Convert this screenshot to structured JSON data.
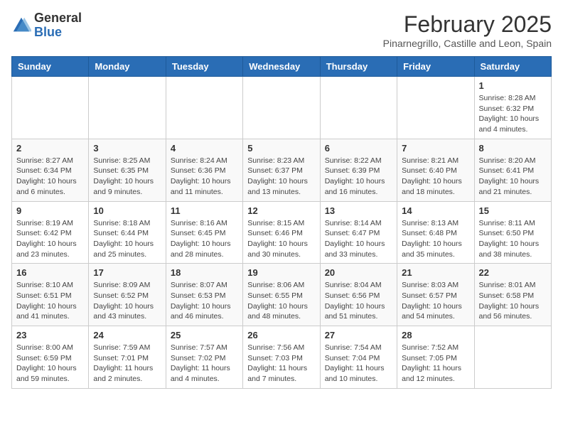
{
  "header": {
    "logo_general": "General",
    "logo_blue": "Blue",
    "month_year": "February 2025",
    "location": "Pinarnegrillo, Castille and Leon, Spain"
  },
  "weekdays": [
    "Sunday",
    "Monday",
    "Tuesday",
    "Wednesday",
    "Thursday",
    "Friday",
    "Saturday"
  ],
  "weeks": [
    [
      {
        "day": "",
        "info": ""
      },
      {
        "day": "",
        "info": ""
      },
      {
        "day": "",
        "info": ""
      },
      {
        "day": "",
        "info": ""
      },
      {
        "day": "",
        "info": ""
      },
      {
        "day": "",
        "info": ""
      },
      {
        "day": "1",
        "info": "Sunrise: 8:28 AM\nSunset: 6:32 PM\nDaylight: 10 hours and 4 minutes."
      }
    ],
    [
      {
        "day": "2",
        "info": "Sunrise: 8:27 AM\nSunset: 6:34 PM\nDaylight: 10 hours and 6 minutes."
      },
      {
        "day": "3",
        "info": "Sunrise: 8:25 AM\nSunset: 6:35 PM\nDaylight: 10 hours and 9 minutes."
      },
      {
        "day": "4",
        "info": "Sunrise: 8:24 AM\nSunset: 6:36 PM\nDaylight: 10 hours and 11 minutes."
      },
      {
        "day": "5",
        "info": "Sunrise: 8:23 AM\nSunset: 6:37 PM\nDaylight: 10 hours and 13 minutes."
      },
      {
        "day": "6",
        "info": "Sunrise: 8:22 AM\nSunset: 6:39 PM\nDaylight: 10 hours and 16 minutes."
      },
      {
        "day": "7",
        "info": "Sunrise: 8:21 AM\nSunset: 6:40 PM\nDaylight: 10 hours and 18 minutes."
      },
      {
        "day": "8",
        "info": "Sunrise: 8:20 AM\nSunset: 6:41 PM\nDaylight: 10 hours and 21 minutes."
      }
    ],
    [
      {
        "day": "9",
        "info": "Sunrise: 8:19 AM\nSunset: 6:42 PM\nDaylight: 10 hours and 23 minutes."
      },
      {
        "day": "10",
        "info": "Sunrise: 8:18 AM\nSunset: 6:44 PM\nDaylight: 10 hours and 25 minutes."
      },
      {
        "day": "11",
        "info": "Sunrise: 8:16 AM\nSunset: 6:45 PM\nDaylight: 10 hours and 28 minutes."
      },
      {
        "day": "12",
        "info": "Sunrise: 8:15 AM\nSunset: 6:46 PM\nDaylight: 10 hours and 30 minutes."
      },
      {
        "day": "13",
        "info": "Sunrise: 8:14 AM\nSunset: 6:47 PM\nDaylight: 10 hours and 33 minutes."
      },
      {
        "day": "14",
        "info": "Sunrise: 8:13 AM\nSunset: 6:48 PM\nDaylight: 10 hours and 35 minutes."
      },
      {
        "day": "15",
        "info": "Sunrise: 8:11 AM\nSunset: 6:50 PM\nDaylight: 10 hours and 38 minutes."
      }
    ],
    [
      {
        "day": "16",
        "info": "Sunrise: 8:10 AM\nSunset: 6:51 PM\nDaylight: 10 hours and 41 minutes."
      },
      {
        "day": "17",
        "info": "Sunrise: 8:09 AM\nSunset: 6:52 PM\nDaylight: 10 hours and 43 minutes."
      },
      {
        "day": "18",
        "info": "Sunrise: 8:07 AM\nSunset: 6:53 PM\nDaylight: 10 hours and 46 minutes."
      },
      {
        "day": "19",
        "info": "Sunrise: 8:06 AM\nSunset: 6:55 PM\nDaylight: 10 hours and 48 minutes."
      },
      {
        "day": "20",
        "info": "Sunrise: 8:04 AM\nSunset: 6:56 PM\nDaylight: 10 hours and 51 minutes."
      },
      {
        "day": "21",
        "info": "Sunrise: 8:03 AM\nSunset: 6:57 PM\nDaylight: 10 hours and 54 minutes."
      },
      {
        "day": "22",
        "info": "Sunrise: 8:01 AM\nSunset: 6:58 PM\nDaylight: 10 hours and 56 minutes."
      }
    ],
    [
      {
        "day": "23",
        "info": "Sunrise: 8:00 AM\nSunset: 6:59 PM\nDaylight: 10 hours and 59 minutes."
      },
      {
        "day": "24",
        "info": "Sunrise: 7:59 AM\nSunset: 7:01 PM\nDaylight: 11 hours and 2 minutes."
      },
      {
        "day": "25",
        "info": "Sunrise: 7:57 AM\nSunset: 7:02 PM\nDaylight: 11 hours and 4 minutes."
      },
      {
        "day": "26",
        "info": "Sunrise: 7:56 AM\nSunset: 7:03 PM\nDaylight: 11 hours and 7 minutes."
      },
      {
        "day": "27",
        "info": "Sunrise: 7:54 AM\nSunset: 7:04 PM\nDaylight: 11 hours and 10 minutes."
      },
      {
        "day": "28",
        "info": "Sunrise: 7:52 AM\nSunset: 7:05 PM\nDaylight: 11 hours and 12 minutes."
      },
      {
        "day": "",
        "info": ""
      }
    ]
  ]
}
